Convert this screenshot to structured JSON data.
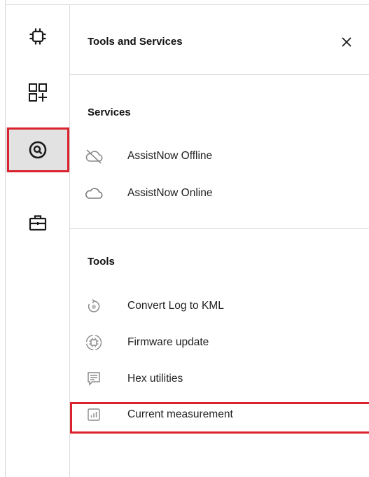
{
  "panel": {
    "title": "Tools and Services"
  },
  "rail": {
    "items": [
      {
        "icon": "chip-icon",
        "active": false
      },
      {
        "icon": "extensions-icon",
        "active": false
      },
      {
        "icon": "tools-services-icon",
        "active": true
      },
      {
        "icon": "toolbox-icon",
        "active": false
      }
    ]
  },
  "services": {
    "heading": "Services",
    "items": [
      {
        "label": "AssistNow Offline",
        "icon": "cloud-off-icon"
      },
      {
        "label": "AssistNow Online",
        "icon": "cloud-icon"
      }
    ]
  },
  "tools": {
    "heading": "Tools",
    "items": [
      {
        "label": "Convert Log to KML",
        "icon": "convert-icon"
      },
      {
        "label": "Firmware update",
        "icon": "firmware-icon"
      },
      {
        "label": "Hex utilities",
        "icon": "hex-icon"
      },
      {
        "label": "Current measurement",
        "icon": "chart-icon",
        "highlighted": true
      }
    ]
  },
  "colors": {
    "highlight": "#d9232e",
    "active_bg": "#e2e2e2",
    "divider": "#dcdcdc",
    "icon_gray": "#8a8a8a"
  }
}
